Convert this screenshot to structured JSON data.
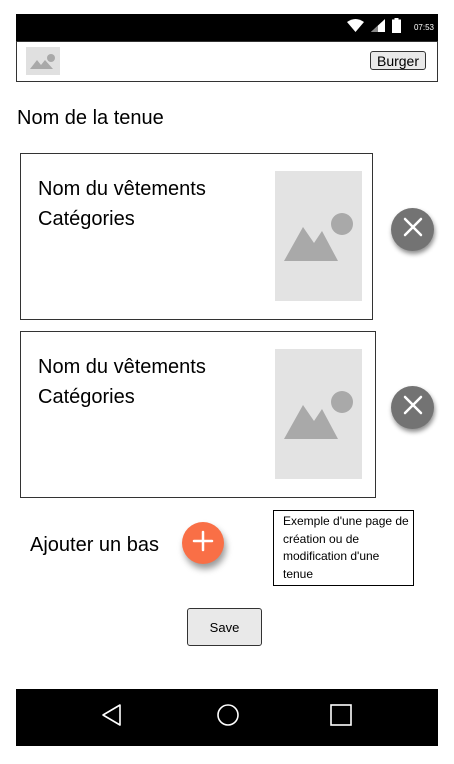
{
  "status_bar": {
    "time": "07:53",
    "icons": [
      "wifi-icon",
      "signal-icon",
      "battery-icon"
    ]
  },
  "app_bar": {
    "logo_icon": "image-placeholder-icon",
    "burger_label": "Burger"
  },
  "outfit": {
    "name_label": "Nom de la tenue"
  },
  "items": [
    {
      "name": "Nom du vêtements",
      "category": "Catégories",
      "image_icon": "image-placeholder-icon",
      "remove_icon": "close-icon"
    },
    {
      "name": "Nom du vêtements",
      "category": "Catégories",
      "image_icon": "image-placeholder-icon",
      "remove_icon": "close-icon"
    }
  ],
  "add_bottom": {
    "label": "Ajouter un bas",
    "icon": "plus-icon"
  },
  "note": {
    "text": "Exemple d'une page de création ou de modification d'une tenue"
  },
  "save": {
    "label": "Save"
  },
  "nav": {
    "icons": [
      "back-triangle-icon",
      "home-circle-icon",
      "recent-square-icon"
    ]
  },
  "colors": {
    "add_button": "#f96f46",
    "remove_button": "#737373",
    "placeholder_bg": "#e3e3e3",
    "bars": "#000000"
  }
}
